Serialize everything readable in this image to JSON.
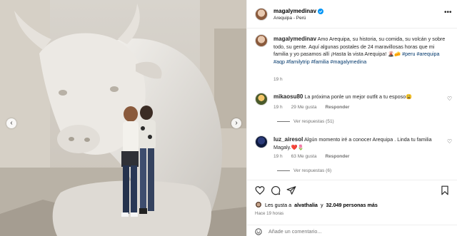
{
  "header": {
    "username": "magalymedinav",
    "location": "Arequipa - Perú",
    "more_icon": "more-horizontal-icon"
  },
  "caption": {
    "username": "magalymedinav",
    "text": "Amo Arequipa, su historia, su comida, su volcán y sobre todo, su gente. Aquí algunas postales de 24 maravillosas horas que mi familia y yo pasamos allí ¡Hasta la vista Arequipa! 🌋🧀",
    "hashtags": "#peru #arequipa #aqp #familytrip #familia #magalymedina",
    "time": "19 h"
  },
  "comments": [
    {
      "username": "mikaosu80",
      "text": "La próxima ponle un mejor outfit a tu esposo😩",
      "time": "19 h",
      "likes": "29 Me gusta",
      "reply": "Responder",
      "view_replies": "Ver respuestas (51)"
    },
    {
      "username": "luz_airesol",
      "text": "Algún momento iré a conocer Arequipa . Linda tu familia Magaly.❤️🌷",
      "time": "19 h",
      "likes": "63 Me gusta",
      "reply": "Responder",
      "view_replies": "Ver respuestas (6)"
    }
  ],
  "likes": {
    "prefix": "Les gusta a",
    "first_user": "alvathalia",
    "connector": "y",
    "others": "32.049 personas más"
  },
  "posted_time": "Hace 19 horas",
  "comment_input": {
    "placeholder": "Añade un comentario..."
  },
  "icons": [
    "heart-icon",
    "comment-icon",
    "share-icon",
    "save-icon",
    "emoji-icon",
    "verified-icon"
  ],
  "colors": {
    "link": "#00376b",
    "verified": "#0095f6",
    "muted": "#737373"
  }
}
